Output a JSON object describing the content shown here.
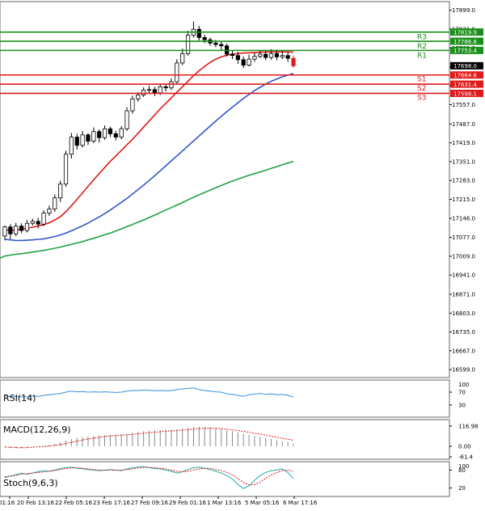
{
  "chart_data": {
    "type": "candlestick",
    "price_panel": {
      "ylim": [
        16570,
        17930
      ],
      "y_ticks": [
        17899.0,
        17831.0,
        17762.0,
        17694.0,
        17626.0,
        17557.0,
        17487.0,
        17419.0,
        17351.0,
        17283.0,
        17215.0,
        17146.0,
        17077.0,
        17009.0,
        16941.0,
        16871.0,
        16803.0,
        16735.0,
        16667.0,
        16599.0
      ],
      "current_price": "17698.0",
      "levels": [
        {
          "name": "R3",
          "value": 17819.9,
          "label": "17819.9",
          "color": "#1a8f1a"
        },
        {
          "name": "R2",
          "value": 17786.6,
          "label": "17786.6",
          "color": "#1a8f1a"
        },
        {
          "name": "R1",
          "value": 17753.4,
          "label": "17753.4",
          "color": "#1a8f1a"
        },
        {
          "name": "S1",
          "value": 17664.6,
          "label": "17664.6",
          "color": "#e01a1a"
        },
        {
          "name": "S2",
          "value": 17631.4,
          "label": "17631.4",
          "color": "#e01a1a"
        },
        {
          "name": "S3",
          "value": 17598.1,
          "label": "17598.1",
          "color": "#e01a1a"
        }
      ],
      "candles": [
        [
          17082,
          17115,
          17066,
          17120
        ],
        [
          17115,
          17090,
          17070,
          17125
        ],
        [
          17090,
          17118,
          17082,
          17130
        ],
        [
          17118,
          17102,
          17092,
          17128
        ],
        [
          17102,
          17128,
          17095,
          17140
        ],
        [
          17128,
          17135,
          17120,
          17145
        ],
        [
          17135,
          17125,
          17110,
          17148
        ],
        [
          17125,
          17165,
          17118,
          17175
        ],
        [
          17165,
          17180,
          17155,
          17192
        ],
        [
          17180,
          17220,
          17170,
          17232
        ],
        [
          17220,
          17270,
          17205,
          17282
        ],
        [
          17270,
          17378,
          17260,
          17390
        ],
        [
          17378,
          17440,
          17362,
          17455
        ],
        [
          17440,
          17410,
          17395,
          17452
        ],
        [
          17410,
          17448,
          17402,
          17462
        ],
        [
          17448,
          17425,
          17412,
          17455
        ],
        [
          17425,
          17460,
          17418,
          17475
        ],
        [
          17460,
          17438,
          17420,
          17468
        ],
        [
          17438,
          17470,
          17430,
          17482
        ],
        [
          17470,
          17452,
          17440,
          17478
        ],
        [
          17452,
          17440,
          17428,
          17462
        ],
        [
          17440,
          17470,
          17432,
          17480
        ],
        [
          17470,
          17535,
          17462,
          17548
        ],
        [
          17535,
          17578,
          17525,
          17590
        ],
        [
          17578,
          17592,
          17568,
          17602
        ],
        [
          17592,
          17610,
          17585,
          17620
        ],
        [
          17610,
          17612,
          17600,
          17625
        ],
        [
          17612,
          17600,
          17588,
          17622
        ],
        [
          17600,
          17622,
          17592,
          17632
        ],
        [
          17622,
          17618,
          17605,
          17630
        ],
        [
          17618,
          17640,
          17610,
          17652
        ],
        [
          17640,
          17708,
          17632,
          17722
        ],
        [
          17708,
          17742,
          17700,
          17760
        ],
        [
          17742,
          17808,
          17735,
          17825
        ],
        [
          17808,
          17830,
          17800,
          17858
        ],
        [
          17830,
          17800,
          17790,
          17842
        ],
        [
          17800,
          17792,
          17780,
          17810
        ],
        [
          17792,
          17780,
          17770,
          17800
        ],
        [
          17780,
          17775,
          17765,
          17792
        ],
        [
          17775,
          17770,
          17755,
          17785
        ],
        [
          17770,
          17740,
          17732,
          17778
        ],
        [
          17740,
          17735,
          17722,
          17752
        ],
        [
          17735,
          17720,
          17705,
          17748
        ],
        [
          17720,
          17700,
          17690,
          17732
        ],
        [
          17700,
          17722,
          17695,
          17738
        ],
        [
          17722,
          17732,
          17712,
          17745
        ],
        [
          17732,
          17740,
          17725,
          17752
        ],
        [
          17740,
          17728,
          17718,
          17752
        ],
        [
          17728,
          17742,
          17720,
          17758
        ],
        [
          17742,
          17730,
          17718,
          17756
        ],
        [
          17730,
          17735,
          17722,
          17752
        ],
        [
          17735,
          17725,
          17712,
          17748
        ],
        [
          17725,
          17698,
          17690,
          17736
        ]
      ],
      "ma_red": [
        17105,
        17102,
        17104,
        17106,
        17110,
        17114,
        17118,
        17123,
        17130,
        17140,
        17152,
        17170,
        17192,
        17215,
        17238,
        17262,
        17285,
        17308,
        17330,
        17352,
        17372,
        17392,
        17412,
        17432,
        17454,
        17476,
        17498,
        17520,
        17542,
        17562,
        17582,
        17602,
        17622,
        17642,
        17662,
        17680,
        17696,
        17710,
        17722,
        17730,
        17736,
        17740,
        17742,
        17744,
        17745,
        17746,
        17747,
        17748,
        17748,
        17748,
        17748,
        17748,
        17747
      ],
      "ma_blue": [
        17070,
        17068,
        17066,
        17066,
        17067,
        17068,
        17070,
        17072,
        17076,
        17080,
        17086,
        17093,
        17101,
        17110,
        17119,
        17129,
        17140,
        17151,
        17163,
        17176,
        17190,
        17204,
        17218,
        17234,
        17250,
        17266,
        17283,
        17300,
        17318,
        17336,
        17354,
        17372,
        17390,
        17408,
        17426,
        17444,
        17462,
        17480,
        17498,
        17515,
        17532,
        17548,
        17564,
        17580,
        17594,
        17608,
        17620,
        17632,
        17642,
        17650,
        17658,
        17664,
        17670
      ],
      "ma_green": [
        17010,
        17013,
        17016,
        17018,
        17021,
        17024,
        17027,
        17030,
        17034,
        17038,
        17042,
        17047,
        17052,
        17057,
        17062,
        17068,
        17074,
        17080,
        17087,
        17093,
        17100,
        17108,
        17116,
        17124,
        17132,
        17140,
        17149,
        17158,
        17167,
        17176,
        17185,
        17194,
        17203,
        17213,
        17222,
        17231,
        17240,
        17248,
        17257,
        17265,
        17273,
        17281,
        17288,
        17295,
        17302,
        17308,
        17314,
        17320,
        17327,
        17333,
        17340,
        17346,
        17352
      ]
    },
    "rsi": {
      "label": "RSI(14)",
      "ylim": [
        0,
        100
      ],
      "y_ticks": [
        70,
        30
      ],
      "top_tick": "100",
      "values": [
        58,
        56,
        57,
        55,
        56,
        58,
        57,
        60,
        62,
        64,
        66,
        70,
        73,
        71,
        72,
        70,
        71,
        70,
        71,
        70,
        69,
        70,
        73,
        75,
        75,
        76,
        76,
        74,
        75,
        74,
        75,
        78,
        80,
        82,
        83,
        78,
        75,
        73,
        71,
        70,
        65,
        63,
        60,
        57,
        62,
        64,
        66,
        63,
        65,
        62,
        63,
        60,
        55
      ]
    },
    "macd": {
      "label": "MACD(12,26,9)",
      "ylim": [
        -61.4,
        140
      ],
      "y_ticks": [
        116.98,
        0.0,
        -61.4
      ],
      "y_tick_labels": [
        "116.98",
        "0.00",
        "-61.4"
      ],
      "histogram": [
        -6,
        -10,
        -12,
        -10,
        -6,
        -3,
        0,
        3,
        8,
        15,
        22,
        32,
        42,
        48,
        52,
        56,
        60,
        62,
        64,
        66,
        66,
        68,
        72,
        78,
        83,
        87,
        90,
        92,
        94,
        95,
        96,
        98,
        102,
        108,
        112,
        113,
        112,
        110,
        106,
        100,
        94,
        88,
        80,
        72,
        66,
        60,
        54,
        48,
        42,
        36,
        30,
        24,
        18
      ],
      "signal": [
        -4,
        -6,
        -8,
        -9,
        -8,
        -6,
        -4,
        -2,
        1,
        5,
        10,
        16,
        23,
        30,
        36,
        42,
        47,
        52,
        56,
        60,
        62,
        64,
        66,
        69,
        72,
        75,
        78,
        81,
        84,
        87,
        89,
        91,
        93,
        96,
        99,
        102,
        104,
        105,
        104,
        102,
        99,
        95,
        91,
        86,
        81,
        75,
        70,
        64,
        58,
        52,
        46,
        40,
        35
      ]
    },
    "stoch": {
      "label": "Stoch(9,6,3)",
      "ylim": [
        0,
        100
      ],
      "y_ticks": [
        80,
        20
      ],
      "top_tick": "100",
      "main": [
        55,
        60,
        65,
        70,
        66,
        70,
        75,
        78,
        76,
        80,
        85,
        88,
        90,
        86,
        84,
        82,
        80,
        78,
        80,
        82,
        80,
        78,
        84,
        88,
        90,
        92,
        88,
        85,
        84,
        80,
        76,
        70,
        75,
        82,
        88,
        90,
        86,
        82,
        76,
        70,
        62,
        50,
        32,
        18,
        28,
        46,
        62,
        72,
        78,
        80,
        84,
        72,
        52
      ],
      "signal": [
        58,
        60,
        62,
        66,
        68,
        70,
        72,
        74,
        76,
        78,
        82,
        85,
        87,
        88,
        86,
        84,
        82,
        80,
        79,
        80,
        80,
        80,
        81,
        84,
        87,
        89,
        89,
        88,
        86,
        84,
        80,
        76,
        74,
        76,
        80,
        84,
        86,
        86,
        82,
        78,
        72,
        64,
        52,
        38,
        30,
        32,
        40,
        52,
        64,
        72,
        78,
        80,
        76
      ]
    },
    "x_axis_labels": [
      "01:16",
      "20 Feb 13:16",
      "22 Feb 05:16",
      "23 Feb 17:16",
      "27 Feb 09:16",
      "29 Feb 01:16",
      "1 Mar 13:16",
      "5 Mar 05:16",
      "6 Mar 17:16"
    ],
    "colors": {
      "bull_body": "#ffffff",
      "bear_body": "#000000",
      "last_candle": "#e01a1a",
      "ma_red": "#e01a1a",
      "ma_blue": "#3355cc",
      "ma_green": "#22a04a",
      "rsi_line": "#3a8fd8",
      "macd_signal": "#e01a1a",
      "stoch_main": "#22aaaa",
      "stoch_signal": "#e01a1a",
      "grid_line": "#666666"
    }
  }
}
